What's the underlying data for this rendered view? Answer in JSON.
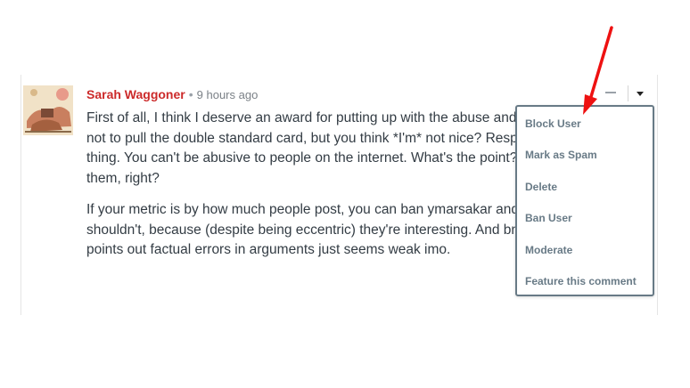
{
  "comment": {
    "author": "Sarah Waggoner",
    "separator": "•",
    "timestamp": "9 hours ago",
    "paragraphs": [
      "First of all, I think I deserve an award for putting up with the abuse and threats here. So not to pull the double standard card, but you think *I'm* not nice? Respect isn't a partisan thing. You can't be abusive to people on the internet. What's the point? You'll never see them, right?",
      "If your metric is by how much people post, you can ban ymarsakar and Neowayland. You shouldn't, because (despite being eccentric) they're interesting. And bnning someone who points out factual errors in arguments just seems weak imo."
    ]
  },
  "controls": {
    "collapse_icon": "minus-icon",
    "menu_icon": "caret-down-icon"
  },
  "menu": {
    "items": [
      "Block User",
      "Mark as Spam",
      "Delete",
      "Ban User",
      "Moderate",
      "Feature this comment"
    ]
  },
  "colors": {
    "author": "#cc2a2a",
    "menu_text": "#687a86",
    "menu_border": "#687a86",
    "annotation_arrow": "#ee1111"
  }
}
